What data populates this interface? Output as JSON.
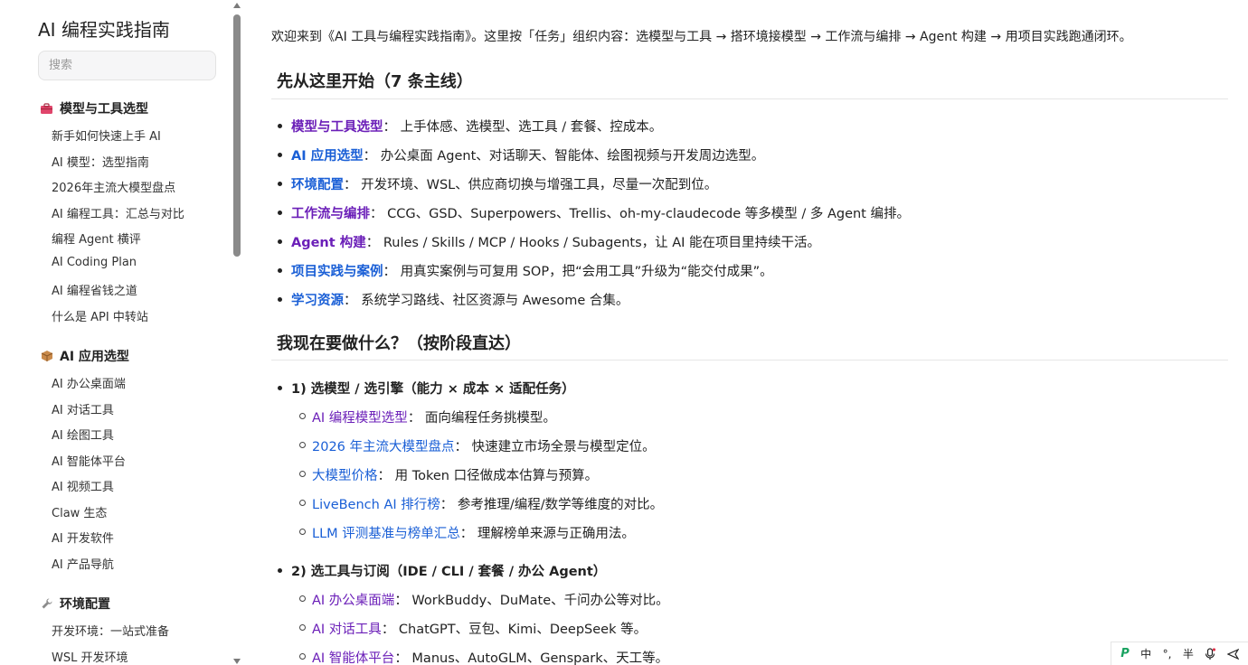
{
  "site": {
    "title": "AI 编程实践指南"
  },
  "search": {
    "placeholder": "搜索"
  },
  "sidebar": {
    "sections": [
      {
        "title": "模型与工具选型",
        "icon": "toolbox-icon",
        "items": [
          "新手如何快速上手 AI",
          "AI 模型：选型指南",
          "2026年主流大模型盘点",
          "AI 编程工具：汇总与对比",
          "编程 Agent 横评",
          "AI Coding Plan",
          "AI 编程省钱之道",
          "什么是 API 中转站"
        ]
      },
      {
        "title": "AI 应用选型",
        "icon": "package-icon",
        "items": [
          "AI 办公桌面端",
          "AI 对话工具",
          "AI 绘图工具",
          "AI 智能体平台",
          "AI 视频工具",
          "Claw 生态",
          "AI 开发软件",
          "AI 产品导航"
        ]
      },
      {
        "title": "环境配置",
        "icon": "wrench-icon",
        "items": [
          "开发环境：一站式准备",
          "WSL 开发环境"
        ]
      }
    ]
  },
  "main": {
    "intro": "欢迎来到《AI 工具与编程实践指南》。这里按「任务」组织内容：选模型与工具 → 搭环境接模型 → 工作流与编排 → Agent 构建 → 用项目实践跑通闭环。",
    "section1": {
      "heading": "先从这里开始（7 条主线）",
      "items": [
        {
          "link": "模型与工具选型",
          "text": "： 上手体感、选模型、选工具 / 套餐、控成本。"
        },
        {
          "link": "AI 应用选型",
          "text": "： 办公桌面 Agent、对话聊天、智能体、绘图视频与开发周边选型。"
        },
        {
          "link": "环境配置",
          "text": "： 开发环境、WSL、供应商切换与增强工具，尽量一次配到位。"
        },
        {
          "link": "工作流与编排",
          "text": "： CCG、GSD、Superpowers、Trellis、oh-my-claudecode 等多模型 / 多 Agent 编排。"
        },
        {
          "link": "Agent 构建",
          "text": "： Rules / Skills / MCP / Hooks / Subagents，让 AI 能在项目里持续干活。"
        },
        {
          "link": "项目实践与案例",
          "text": "： 用真实案例与可复用 SOP，把“会用工具”升级为“能交付成果”。"
        },
        {
          "link": "学习资源",
          "text": "： 系统学习路线、社区资源与 Awesome 合集。"
        }
      ]
    },
    "section2": {
      "heading": "我现在要做什么？（按阶段直达）",
      "groups": [
        {
          "title": "1) 选模型 / 选引擎（能力 × 成本 × 适配任务）",
          "items": [
            {
              "link": "AI 编程模型选型",
              "text": "： 面向编程任务挑模型。"
            },
            {
              "link": "2026 年主流大模型盘点",
              "text": "： 快速建立市场全景与模型定位。"
            },
            {
              "link": "大模型价格",
              "text": "： 用 Token 口径做成本估算与预算。"
            },
            {
              "link": "LiveBench AI 排行榜",
              "text": "： 参考推理/编程/数学等维度的对比。"
            },
            {
              "link": "LLM 评测基准与榜单汇总",
              "text": "： 理解榜单来源与正确用法。"
            }
          ]
        },
        {
          "title": "2) 选工具与订阅（IDE / CLI / 套餐 / 办公 Agent）",
          "items": [
            {
              "link": "AI 办公桌面端",
              "text": "： WorkBuddy、DuMate、千问办公等对比。"
            },
            {
              "link": "AI 对话工具",
              "text": "： ChatGPT、豆包、Kimi、DeepSeek 等。"
            },
            {
              "link": "AI 智能体平台",
              "text": "： Manus、AutoGLM、Genspark、天工等。"
            }
          ]
        }
      ]
    }
  },
  "ime": {
    "logo": "P",
    "lang": "中",
    "punct": "°,",
    "width": "半",
    "mic": "mic-icon",
    "send": "send-icon"
  },
  "colors": {
    "link_purple": "#6b1fb8",
    "link_blue": "#1a5fd6"
  }
}
